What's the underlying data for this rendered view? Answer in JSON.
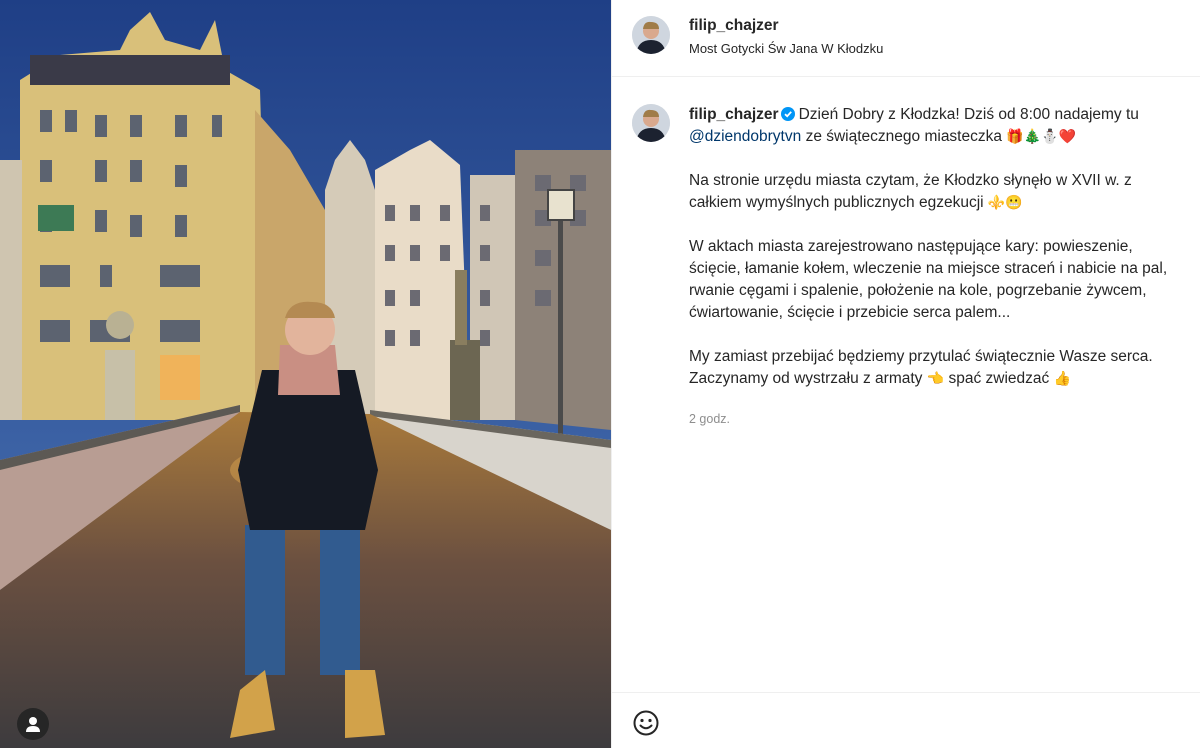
{
  "post": {
    "username": "filip_chajzer",
    "location": "Most Gotycki Św Jana W Kłodzku"
  },
  "caption": {
    "username": "filip_chajzer",
    "line1": "Dzień Dobry z Kłodzka! Dziś od 8:00 nadajemy tu",
    "mention": "@dziendobrytvn",
    "line2": "ze świątecznego miasteczka",
    "line2_emoji": "🎁🎄⛄❤️",
    "para2": "Na stronie urzędu miasta czytam, że Kłodzko słynęło w XVII w. z całkiem wymyślnych publicznych egzekucji",
    "para2_emoji": "⚜️😬",
    "para3": "W aktach miasta zarejestrowano następujące kary: powieszenie, ścięcie, łamanie kołem, wleczenie na miejsce straceń i nabicie na pal, rwanie cęgami i spalenie, położenie na kole, pogrzebanie żywcem, ćwiartowanie, ścięcie i przebicie serca palem...",
    "para4": "My zamiast przebijać będziemy przytulać świątecznie Wasze serca. Zaczynamy od wystrzału z armaty",
    "para4_emoji_a": "👈",
    "para4_mid": "spać zwiedzać",
    "para4_emoji_b": "👍",
    "timestamp": "2 godz."
  },
  "icons": {
    "verified": "verified-badge-icon",
    "emoji": "emoji-smiley-icon",
    "tag": "user-tag-icon"
  },
  "colors": {
    "verified": "#0095f6",
    "mention": "#00376b",
    "muted": "#8e8e8e"
  }
}
